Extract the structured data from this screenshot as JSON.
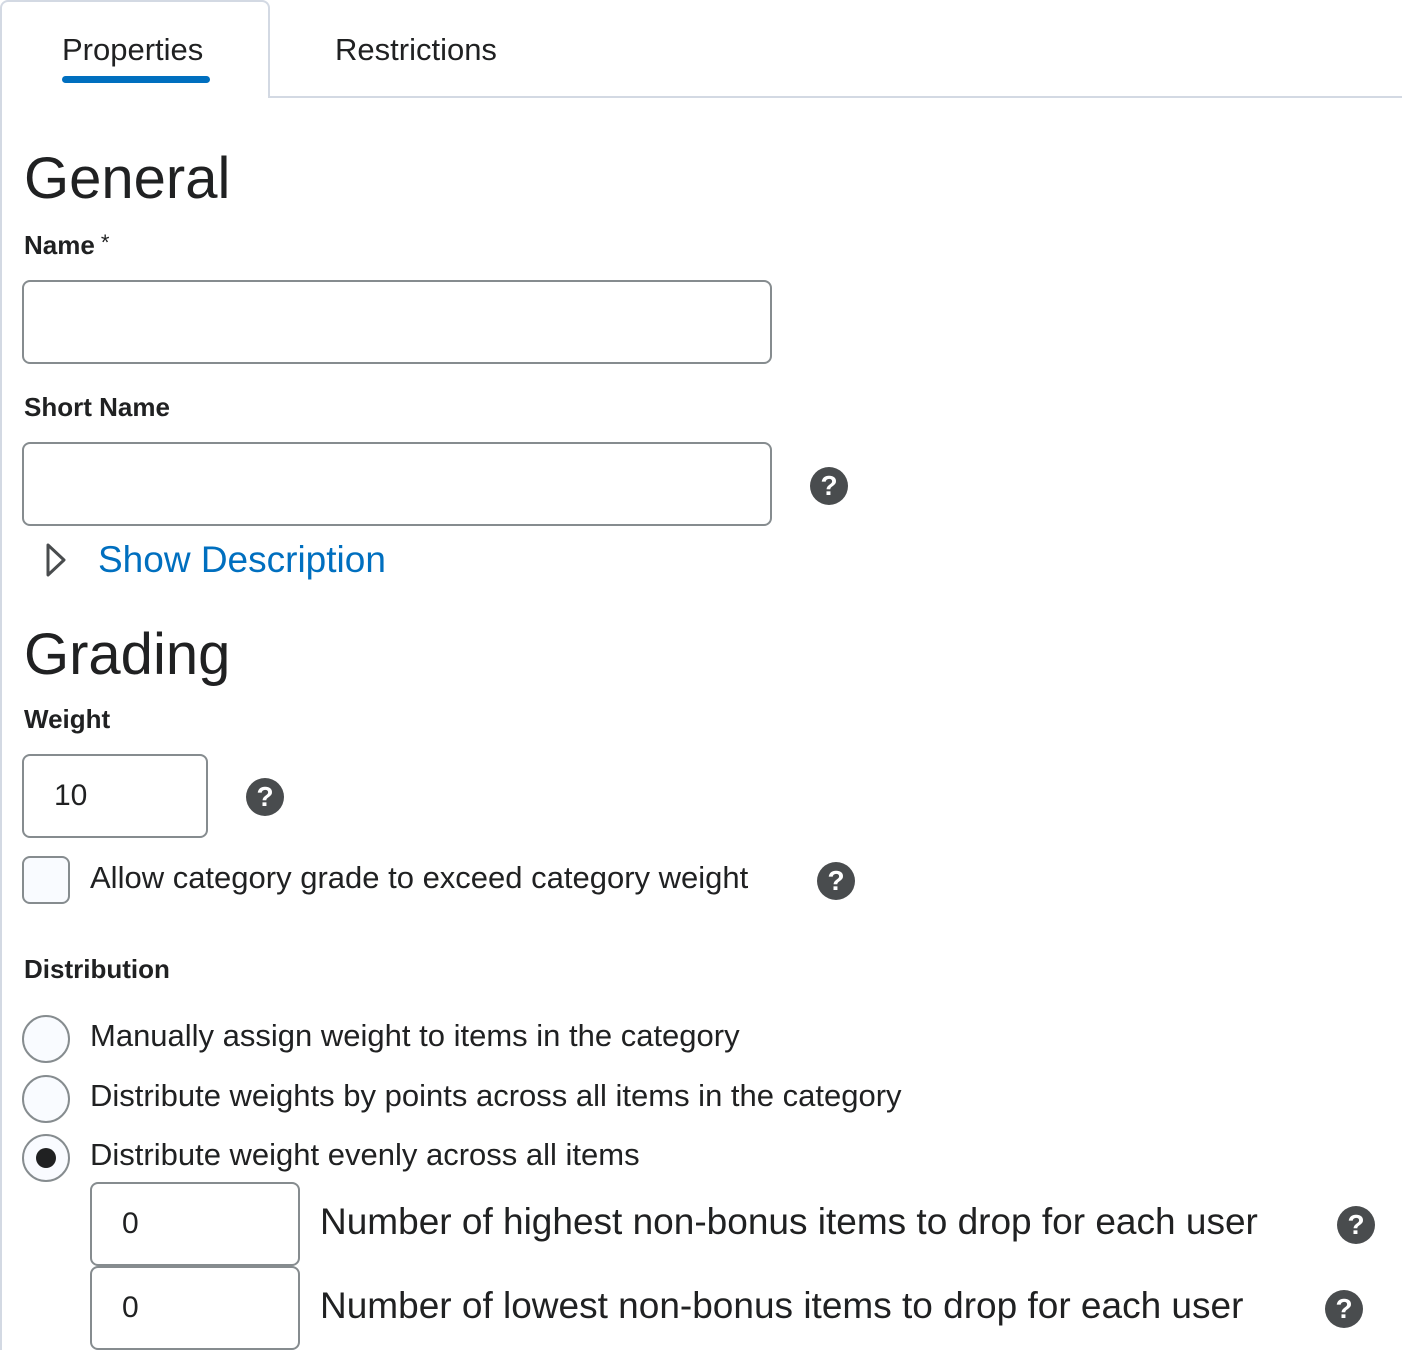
{
  "tabs": [
    {
      "label": "Properties",
      "active": true
    },
    {
      "label": "Restrictions",
      "active": false
    }
  ],
  "general": {
    "heading": "General",
    "name_label": "Name",
    "required_mark": "*",
    "name_value": "",
    "short_name_label": "Short Name",
    "short_name_value": "",
    "show_description": "Show Description"
  },
  "grading": {
    "heading": "Grading",
    "weight_label": "Weight",
    "weight_value": "10",
    "exceed_label": "Allow category grade to exceed category weight",
    "exceed_checked": false,
    "distribution_label": "Distribution",
    "options": [
      {
        "label": "Manually assign weight to items in the category",
        "selected": false
      },
      {
        "label": "Distribute weights by points across all items in the category",
        "selected": false
      },
      {
        "label": "Distribute weight evenly across all items",
        "selected": true
      }
    ],
    "drop_highest_value": "0",
    "drop_highest_label": "Number of highest non-bonus items to drop for each user",
    "drop_lowest_value": "0",
    "drop_lowest_label": "Number of lowest non-bonus items to drop for each user"
  },
  "help_glyph": "?",
  "colors": {
    "link": "#006fbf",
    "tab_indicator": "#006fbf",
    "help_icon": "#494c4e",
    "border": "#868c8f"
  },
  "icons": {
    "help": "help-circle-icon",
    "expand": "triangle-right-icon"
  }
}
